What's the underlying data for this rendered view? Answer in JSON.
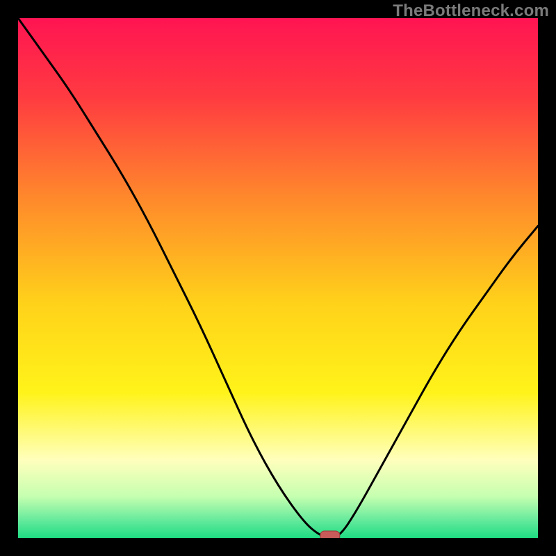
{
  "watermark": "TheBottleneck.com",
  "colors": {
    "bg_black": "#000000",
    "curve": "#000000",
    "marker_fill": "#c85a5a",
    "marker_stroke": "#9a3a3a"
  },
  "chart_data": {
    "type": "line",
    "title": "",
    "xlabel": "",
    "ylabel": "",
    "x": [
      0,
      5,
      10,
      15,
      20,
      25,
      30,
      35,
      40,
      45,
      50,
      55,
      58,
      60,
      62,
      65,
      70,
      75,
      80,
      85,
      90,
      95,
      100
    ],
    "values": [
      100,
      93,
      86,
      78,
      70,
      61,
      51,
      41,
      30,
      19,
      10,
      3,
      0.5,
      0,
      0.5,
      5,
      14,
      23,
      32,
      40,
      47,
      54,
      60
    ],
    "xlim": [
      0,
      100
    ],
    "ylim": [
      0,
      100
    ],
    "marker": {
      "x": 60,
      "y": 0
    },
    "gradient_stops": [
      {
        "offset": 0.0,
        "color": "#ff1452"
      },
      {
        "offset": 0.15,
        "color": "#ff3a41"
      },
      {
        "offset": 0.35,
        "color": "#ff8a2b"
      },
      {
        "offset": 0.55,
        "color": "#ffd21a"
      },
      {
        "offset": 0.72,
        "color": "#fff31a"
      },
      {
        "offset": 0.85,
        "color": "#ffffbc"
      },
      {
        "offset": 0.92,
        "color": "#c6ffb0"
      },
      {
        "offset": 0.97,
        "color": "#5de89a"
      },
      {
        "offset": 1.0,
        "color": "#1edc82"
      }
    ]
  }
}
